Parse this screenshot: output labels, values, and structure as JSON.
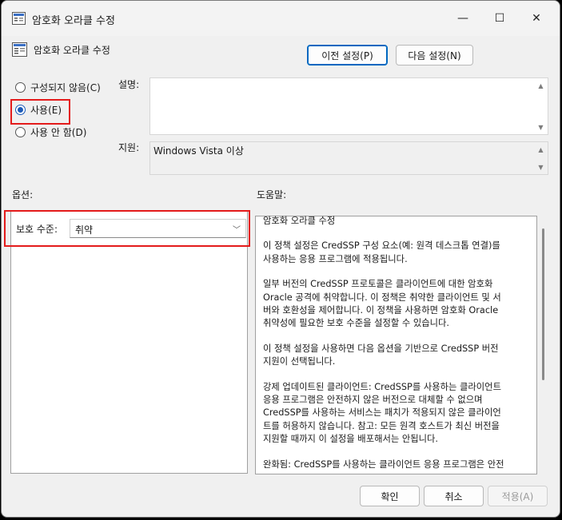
{
  "window": {
    "title": "암호화 오라클 수정",
    "minimize_glyph": "—",
    "maximize_glyph": "☐",
    "close_glyph": "✕"
  },
  "header": {
    "policy_name": "암호화 오라클 수정",
    "prev_button": "이전 설정(P)",
    "next_button": "다음 설정(N)"
  },
  "state": {
    "options": [
      {
        "label": "구성되지 않음(C)",
        "selected": false
      },
      {
        "label": "사용(E)",
        "selected": true
      },
      {
        "label": "사용 안 함(D)",
        "selected": false
      }
    ]
  },
  "comment": {
    "label": "설명:",
    "value": ""
  },
  "supported": {
    "label": "지원:",
    "value": "Windows Vista 이상"
  },
  "options_section": {
    "label": "옵션:",
    "protection_label": "보호 수준:",
    "protection_value": "취약"
  },
  "help_section": {
    "label": "도움말:",
    "paragraphs": [
      "암호화 오라클 수정",
      "이 정책 설정은 CredSSP 구성 요소(예: 원격 데스크톱 연결)를\n사용하는 응용 프로그램에 적용됩니다.",
      "일부 버전의 CredSSP 프로토콜은 클라이언트에 대한 암호화\nOracle 공격에 취약합니다.  이 정책은 취약한 클라이언트 및 서\n버와 호환성을 제어합니다.  이 정책을 사용하면 암호화 Oracle\n취약성에 필요한 보호 수준을 설정할 수 있습니다.",
      "이 정책 설정을 사용하면 다음 옵션을 기반으로 CredSSP 버전\n지원이 선택됩니다.",
      "강제 업데이트된 클라이언트: CredSSP를 사용하는 클라이언트\n응용 프로그램은 안전하지 않은 버전으로 대체할 수 없으며\nCredSSP를 사용하는 서비스는 패치가 적용되지 않은 클라이언\n트를 허용하지 않습니다. 참고: 모든 원격 호스트가 최신 버전을\n지원할 때까지 이 설정을 배포해서는 안됩니다.",
      "완화됨: CredSSP를 사용하는 클라이언트 응용 프로그램은 안전\n하지 않은 버전으로 대체할 수 없지만 CredSSP를 사용하는 서비\n스는 패치가 적용되지 않은 클라이언트를 허용합니다. 패치가 적"
    ]
  },
  "footer": {
    "ok": "확인",
    "cancel": "취소",
    "apply": "적용(A)"
  },
  "colors": {
    "highlight_box": "#e41b1b",
    "accent": "#0067c0"
  }
}
